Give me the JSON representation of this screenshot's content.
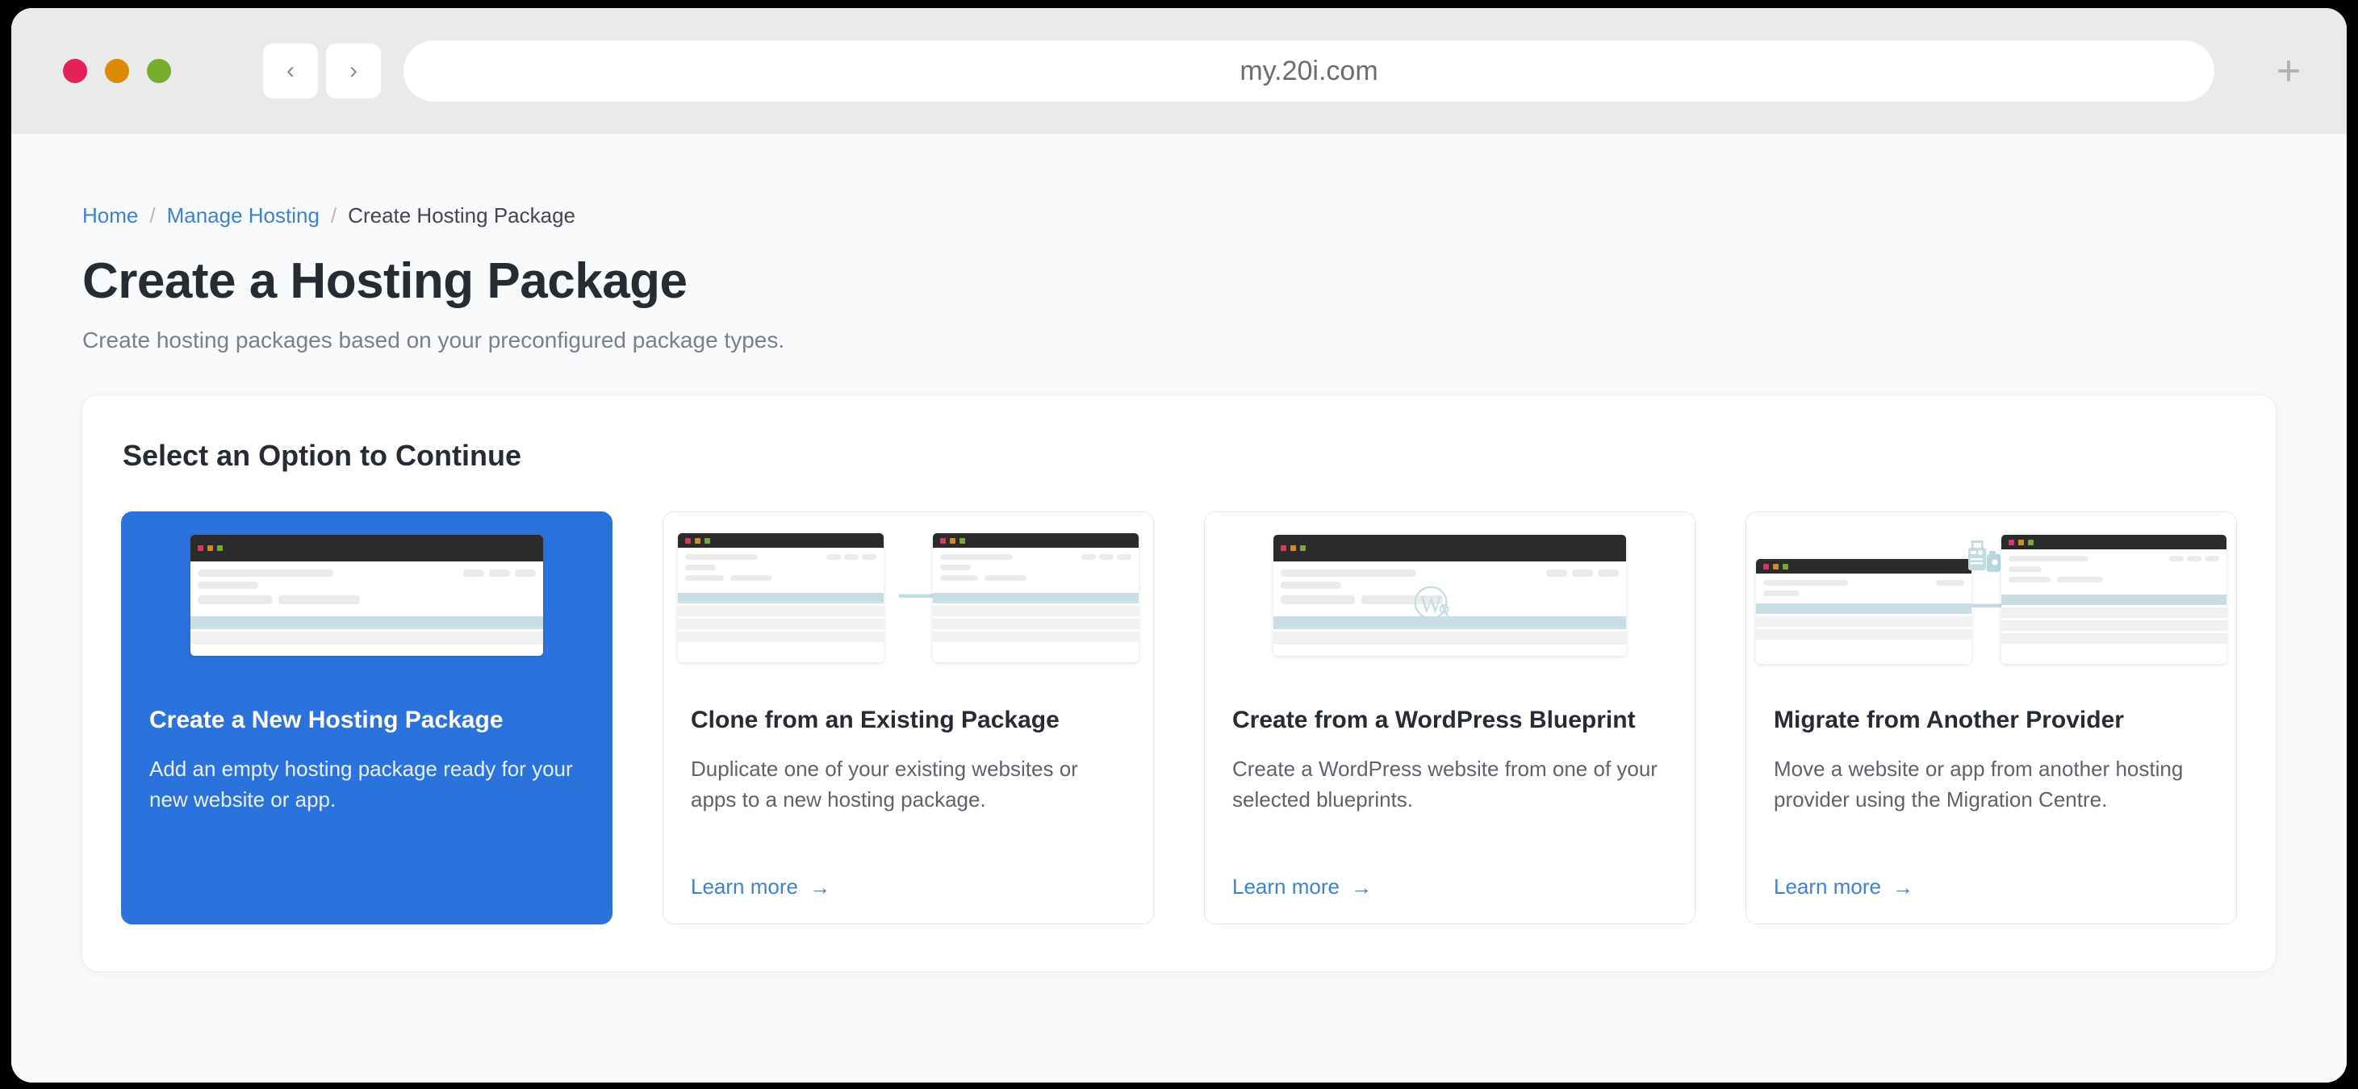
{
  "browser": {
    "url": "my.20i.com",
    "back_label": "‹",
    "forward_label": "›",
    "new_tab_label": "+"
  },
  "breadcrumb": {
    "items": [
      {
        "label": "Home",
        "current": false
      },
      {
        "label": "Manage Hosting",
        "current": false
      },
      {
        "label": "Create Hosting Package",
        "current": true
      }
    ],
    "separator": "/"
  },
  "header": {
    "title": "Create a Hosting Package",
    "subtitle": "Create hosting packages based on your preconfigured package types."
  },
  "panel": {
    "title": "Select an Option to Continue"
  },
  "colors": {
    "accent": "#2b72dd",
    "link": "#3b82d6",
    "page_bg": "#f9fafb",
    "illustration_blue": "#c3dce4"
  },
  "options": [
    {
      "title": "Create a New Hosting Package",
      "description": "Add an empty hosting package ready for your new website or app.",
      "selected": true,
      "learn_more": null,
      "learn_more_arrow": null
    },
    {
      "title": "Clone from an Existing Package",
      "description": "Duplicate one of your existing websites or apps to a new hosting package.",
      "selected": false,
      "learn_more": "Learn more",
      "learn_more_arrow": "→"
    },
    {
      "title": "Create from a WordPress Blueprint",
      "description": "Create a WordPress website from one of your selected blueprints.",
      "selected": false,
      "learn_more": "Learn more",
      "learn_more_arrow": "→"
    },
    {
      "title": "Migrate from Another Provider",
      "description": "Move a website or app from another hosting provider using the Migration Centre.",
      "selected": false,
      "learn_more": "Learn more",
      "learn_more_arrow": "→"
    }
  ]
}
